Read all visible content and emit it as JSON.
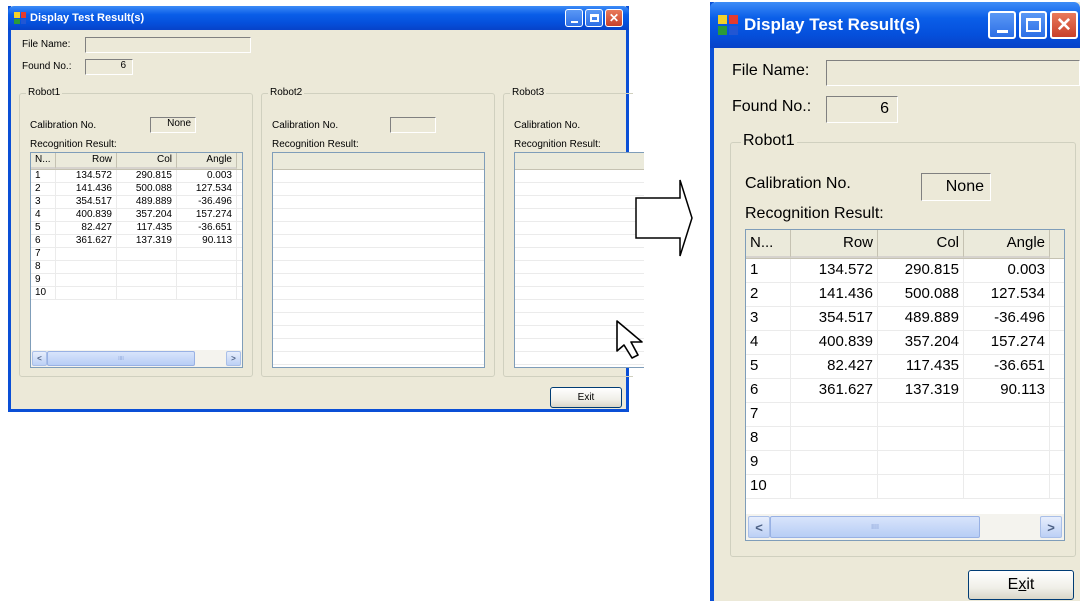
{
  "window": {
    "title": "Display Test Result(s)",
    "file_name_label": "File Name:",
    "file_name_value": "",
    "found_no_label": "Found No.:",
    "found_no_value": "6",
    "exit_label": "Exit",
    "exit_accel": "x"
  },
  "robots": [
    {
      "title": "Robot1",
      "calibration_label": "Calibration No.",
      "calibration_value": "None",
      "recognition_label": "Recognition Result:"
    },
    {
      "title": "Robot2",
      "calibration_label": "Calibration No.",
      "calibration_value": "",
      "recognition_label": "Recognition Result:"
    },
    {
      "title": "Robot3",
      "calibration_label": "Calibration No.",
      "recognition_label": "Recognition Result:"
    }
  ],
  "table": {
    "columns": [
      "N...",
      "Row",
      "Col",
      "Angle"
    ],
    "rows": [
      [
        "1",
        "134.572",
        "290.815",
        "0.003"
      ],
      [
        "2",
        "141.436",
        "500.088",
        "127.534"
      ],
      [
        "3",
        "354.517",
        "489.889",
        "-36.496"
      ],
      [
        "4",
        "400.839",
        "357.204",
        "157.274"
      ],
      [
        "5",
        "82.427",
        "117.435",
        "-36.651"
      ],
      [
        "6",
        "361.627",
        "137.319",
        "90.113"
      ],
      [
        "7",
        "",
        "",
        ""
      ],
      [
        "8",
        "",
        "",
        ""
      ],
      [
        "9",
        "",
        "",
        ""
      ],
      [
        "10",
        "",
        "",
        ""
      ]
    ]
  },
  "scroll_grip": "IIII",
  "colors": {
    "titlebar": "#0550dc",
    "window_bg": "#ece9d8",
    "listview_border": "#7f9db9"
  }
}
